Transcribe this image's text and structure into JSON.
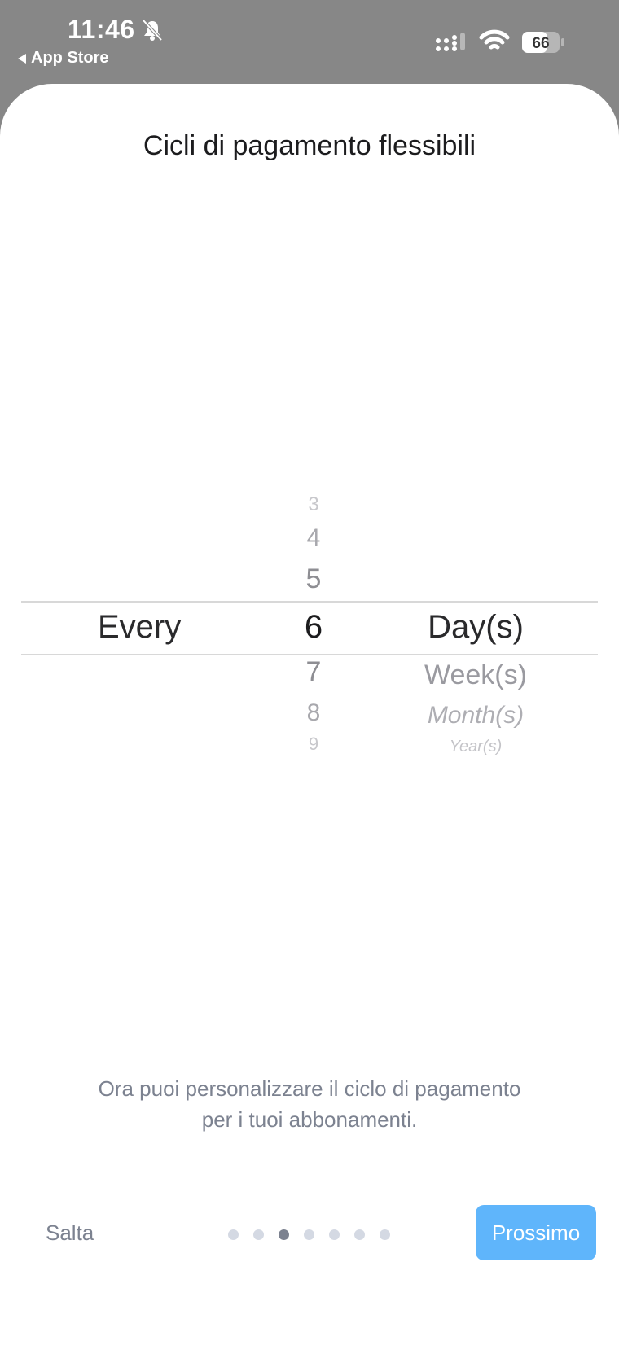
{
  "status_bar": {
    "time": "11:46",
    "back_label": "App Store",
    "battery_level": "66",
    "icons": [
      "bell-slash-icon",
      "cellular-signal-icon",
      "wifi-icon",
      "battery-icon"
    ]
  },
  "onboarding": {
    "title": "Cicli di pagamento flessibili",
    "picker": {
      "label": "Every",
      "numbers_above": [
        "3",
        "4",
        "5"
      ],
      "selected_number": "6",
      "numbers_below": [
        "7",
        "8",
        "9"
      ],
      "selected_unit": "Day(s)",
      "units_below": [
        "Week(s)",
        "Month(s)",
        "Year(s)"
      ]
    },
    "description_line1": "Ora puoi personalizzare il ciclo di pagamento",
    "description_line2": "per i tuoi abbonamenti.",
    "skip_label": "Salta",
    "next_label": "Prossimo",
    "page_count": 7,
    "current_page": 3
  },
  "colors": {
    "accent": "#5fb5fb",
    "muted_text": "#7c8290",
    "dot_inactive": "#d4d9e3"
  }
}
